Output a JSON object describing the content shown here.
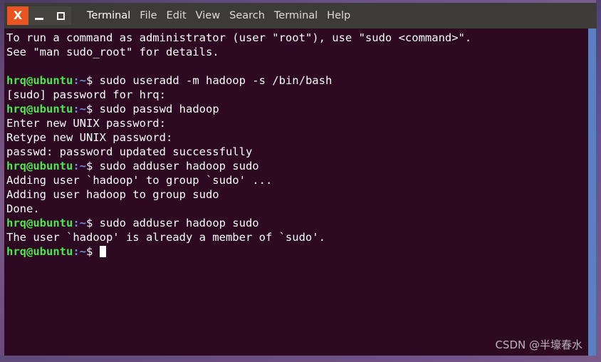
{
  "window": {
    "title": "Terminal",
    "controls": {
      "close_label": "X",
      "close_icon": "close-icon",
      "minimize_icon": "minimize-icon",
      "maximize_icon": "maximize-icon",
      "close_color": "#e95420"
    },
    "titlebar_color": "#3c3b37"
  },
  "menubar": {
    "items": [
      {
        "label": "File"
      },
      {
        "label": "Edit"
      },
      {
        "label": "View"
      },
      {
        "label": "Search"
      },
      {
        "label": "Terminal"
      },
      {
        "label": "Help"
      }
    ]
  },
  "terminal": {
    "background_color": "#2d0922",
    "foreground_color": "#ffffff",
    "prompt_user_color": "#4ee44e",
    "prompt_path_color": "#6a8fe0",
    "prompt_user": "hrq@ubuntu",
    "prompt_path": ":~",
    "prompt_symbol": "$",
    "lines": [
      {
        "type": "output",
        "text": "To run a command as administrator (user \"root\"), use \"sudo <command>\"."
      },
      {
        "type": "output",
        "text": "See \"man sudo_root\" for details."
      },
      {
        "type": "blank",
        "text": ""
      },
      {
        "type": "prompt",
        "command": " sudo useradd -m hadoop -s /bin/bash"
      },
      {
        "type": "output",
        "text": "[sudo] password for hrq:"
      },
      {
        "type": "prompt",
        "command": " sudo passwd hadoop"
      },
      {
        "type": "output",
        "text": "Enter new UNIX password:"
      },
      {
        "type": "output",
        "text": "Retype new UNIX password:"
      },
      {
        "type": "output",
        "text": "passwd: password updated successfully"
      },
      {
        "type": "prompt",
        "command": " sudo adduser hadoop sudo"
      },
      {
        "type": "output",
        "text": "Adding user `hadoop' to group `sudo' ..."
      },
      {
        "type": "output",
        "text": "Adding user hadoop to group sudo"
      },
      {
        "type": "output",
        "text": "Done."
      },
      {
        "type": "prompt",
        "command": " sudo adduser hadoop sudo"
      },
      {
        "type": "output",
        "text": "The user `hadoop' is already a member of `sudo'."
      },
      {
        "type": "prompt_cursor",
        "command": " "
      }
    ]
  },
  "scrollbar": {
    "thumb_color": "#5b7fc0"
  },
  "watermark": {
    "text": "CSDN @半壕春水"
  }
}
